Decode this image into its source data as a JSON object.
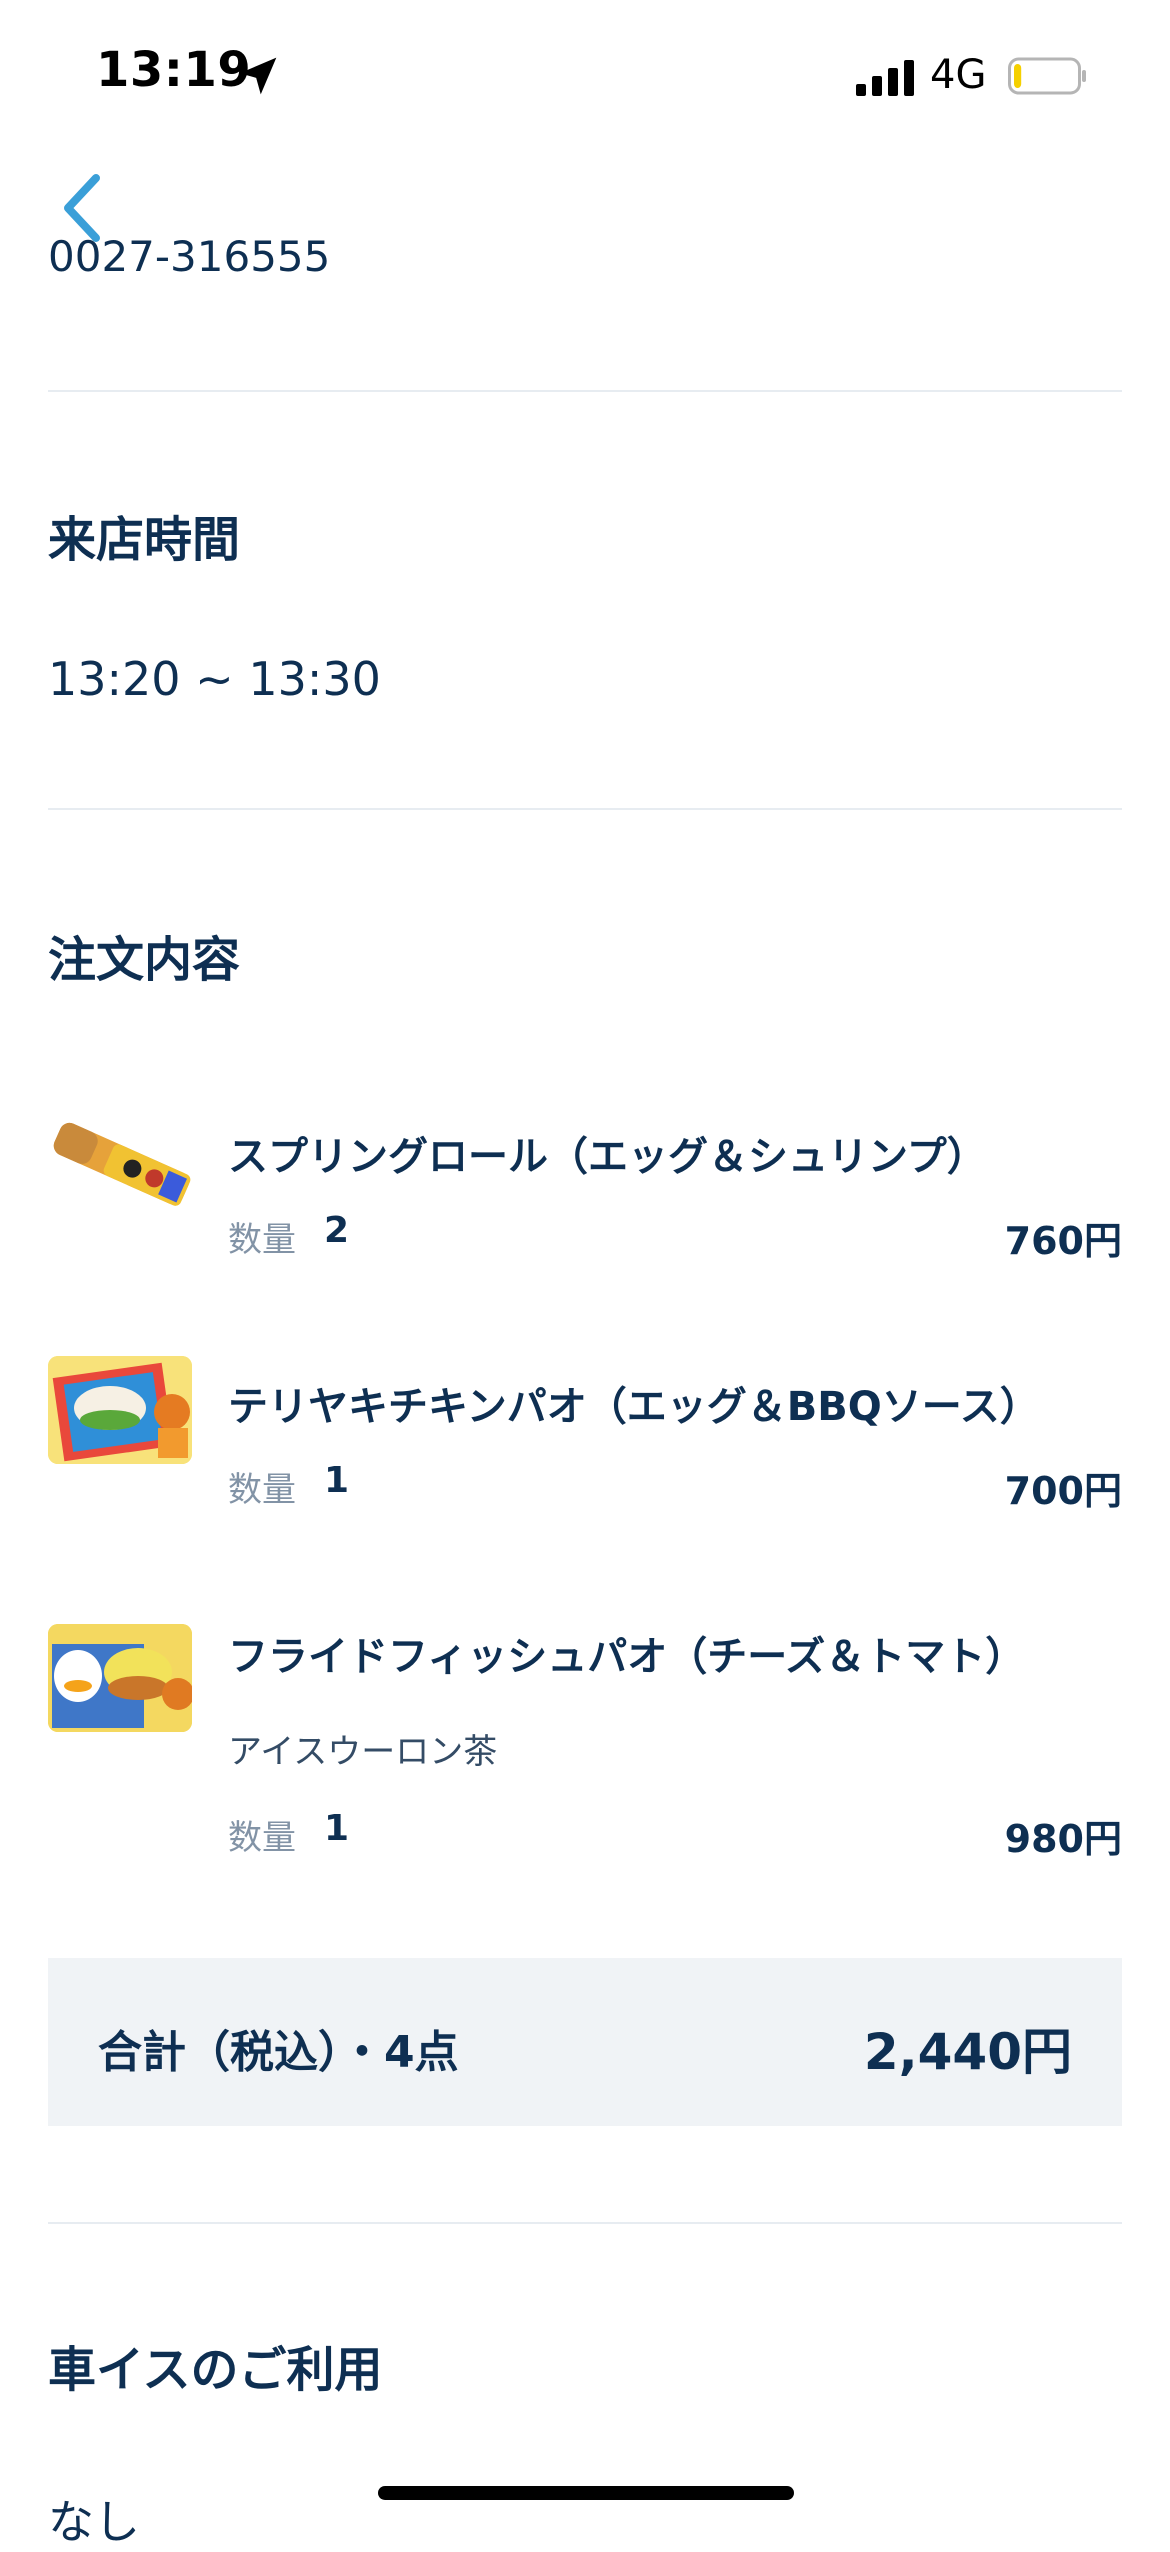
{
  "status_bar": {
    "time": "13:19",
    "network": "4G",
    "battery_level": 0.12
  },
  "nav": {
    "back_icon": "chevron-left-icon"
  },
  "cutoff_text": "0027-316555",
  "visit_time": {
    "title": "来店時間",
    "value": "13:20 ~ 13:30"
  },
  "order": {
    "title": "注文内容",
    "qty_label": "数量",
    "items": [
      {
        "name": "スプリングロール（エッグ＆シュリンプ）",
        "option": "",
        "quantity": "2",
        "price": "760円",
        "thumb_icon": "spring-roll-image"
      },
      {
        "name": "テリヤキチキンパオ（エッグ＆BBQソース）",
        "option": "",
        "quantity": "1",
        "price": "700円",
        "thumb_icon": "teriyaki-pao-image"
      },
      {
        "name": "フライドフィッシュパオ（チーズ＆トマト）",
        "option": "アイスウーロン茶",
        "quantity": "1",
        "price": "980円",
        "thumb_icon": "fish-pao-image"
      }
    ],
    "total_label": "合計（税込）・4点",
    "total_value": "2,440円"
  },
  "wheelchair": {
    "title": "車イスのご利用",
    "value": "なし"
  },
  "colors": {
    "text": "#0e2f52",
    "accent": "#3a9fd8",
    "total_bg": "#f0f3f6"
  }
}
